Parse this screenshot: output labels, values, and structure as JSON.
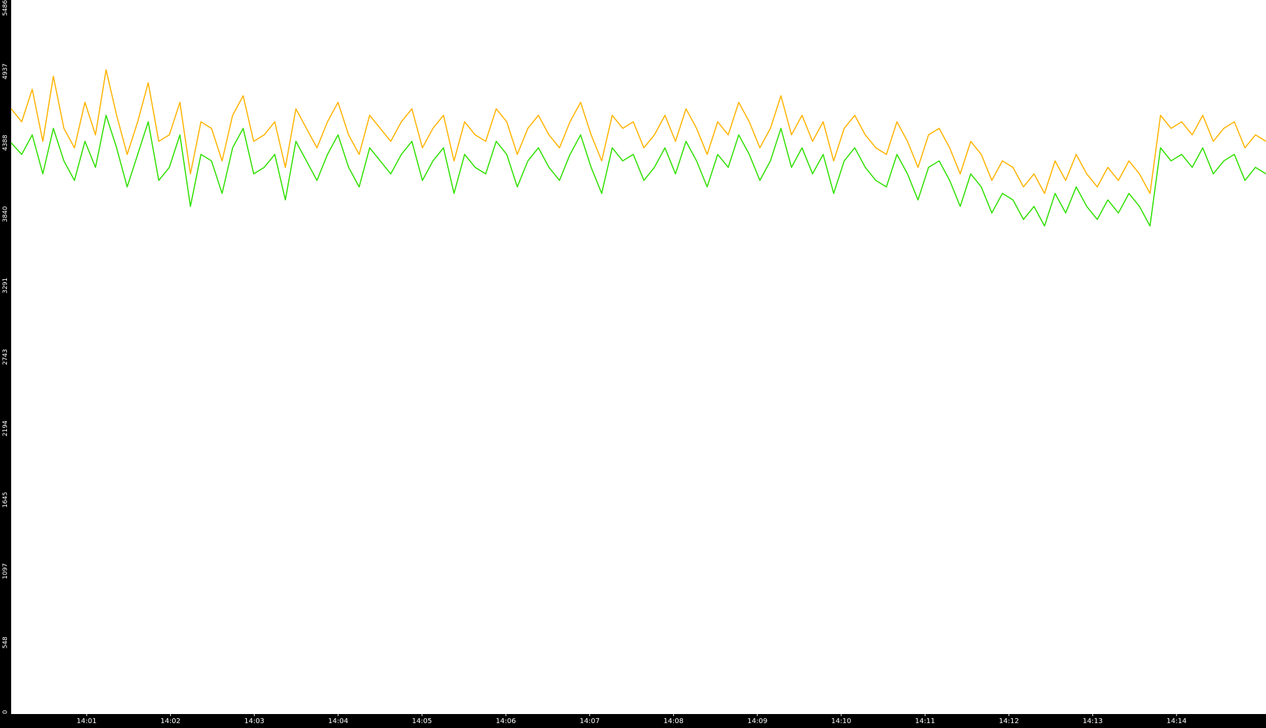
{
  "chart_data": {
    "type": "line",
    "title": "",
    "xlabel": "",
    "ylabel": "",
    "colors": {
      "background": "#000000",
      "plot_background": "#ffffff",
      "axis_text": "#ffffff",
      "series_green": "#2fe000",
      "series_orange": "#ffb300"
    },
    "y_ticks": [
      "0",
      "548",
      "1097",
      "1645",
      "2194",
      "2743",
      "3291",
      "3840",
      "4388",
      "4937",
      "5486"
    ],
    "x_ticks": [
      "14:01",
      "14:02",
      "14:03",
      "14:04",
      "14:05",
      "14:06",
      "14:07",
      "14:08",
      "14:09",
      "14:10",
      "14:11",
      "14:12",
      "14:13",
      "14:14"
    ],
    "ylim": [
      0,
      5486
    ],
    "xlim_seconds_from_14_00": [
      6,
      904
    ],
    "grid": false,
    "legend": "none",
    "series": [
      {
        "color_key": "series_green",
        "values": [
          4388,
          4300,
          4450,
          4150,
          4500,
          4250,
          4100,
          4400,
          4200,
          4600,
          4350,
          4050,
          4300,
          4550,
          4100,
          4200,
          4450,
          3900,
          4300,
          4250,
          4000,
          4350,
          4500,
          4150,
          4200,
          4300,
          3950,
          4400,
          4250,
          4100,
          4300,
          4450,
          4200,
          4050,
          4350,
          4250,
          4150,
          4300,
          4400,
          4100,
          4250,
          4350,
          4000,
          4300,
          4200,
          4150,
          4400,
          4300,
          4050,
          4250,
          4350,
          4200,
          4100,
          4300,
          4450,
          4200,
          4000,
          4350,
          4250,
          4300,
          4100,
          4200,
          4350,
          4150,
          4400,
          4250,
          4050,
          4300,
          4200,
          4450,
          4300,
          4100,
          4250,
          4500,
          4200,
          4350,
          4150,
          4300,
          4000,
          4250,
          4350,
          4200,
          4100,
          4050,
          4300,
          4150,
          3950,
          4200,
          4250,
          4100,
          3900,
          4150,
          4050,
          3850,
          4000,
          3950,
          3800,
          3900,
          3750,
          4000,
          3850,
          4050,
          3900,
          3800,
          3950,
          3850,
          4000,
          3900,
          3750,
          4350,
          4250,
          4300,
          4200,
          4350,
          4150,
          4250,
          4300,
          4100,
          4200,
          4150
        ]
      },
      {
        "color_key": "series_orange",
        "values": [
          4650,
          4550,
          4800,
          4400,
          4900,
          4500,
          4350,
          4700,
          4450,
          4950,
          4600,
          4300,
          4550,
          4850,
          4400,
          4450,
          4700,
          4150,
          4550,
          4500,
          4250,
          4600,
          4750,
          4400,
          4450,
          4550,
          4200,
          4650,
          4500,
          4350,
          4550,
          4700,
          4450,
          4300,
          4600,
          4500,
          4400,
          4550,
          4650,
          4350,
          4500,
          4600,
          4250,
          4550,
          4450,
          4400,
          4650,
          4550,
          4300,
          4500,
          4600,
          4450,
          4350,
          4550,
          4700,
          4450,
          4250,
          4600,
          4500,
          4550,
          4350,
          4450,
          4600,
          4400,
          4650,
          4500,
          4300,
          4550,
          4450,
          4700,
          4550,
          4350,
          4500,
          4750,
          4450,
          4600,
          4400,
          4550,
          4250,
          4500,
          4600,
          4450,
          4350,
          4300,
          4550,
          4400,
          4200,
          4450,
          4500,
          4350,
          4150,
          4400,
          4300,
          4100,
          4250,
          4200,
          4050,
          4150,
          4000,
          4250,
          4100,
          4300,
          4150,
          4050,
          4200,
          4100,
          4250,
          4150,
          4000,
          4600,
          4500,
          4550,
          4450,
          4600,
          4400,
          4500,
          4550,
          4350,
          4450,
          4400
        ]
      }
    ]
  }
}
